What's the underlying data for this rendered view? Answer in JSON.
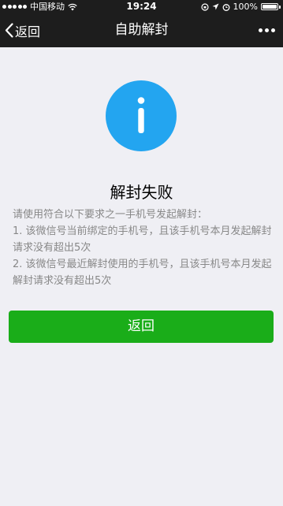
{
  "status_bar": {
    "carrier": "中国移动",
    "time": "19:24",
    "battery": "100%",
    "battery_level": 1.0
  },
  "nav": {
    "back_label": "返回",
    "title": "自助解封"
  },
  "result": {
    "title": "解封失败",
    "intro": "请使用符合以下要求之一手机号发起解封：",
    "items": [
      "1. 该微信号当前绑定的手机号，且该手机号本月发起解封请求没有超出5次",
      "2. 该微信号最近解封使用的手机号，且该手机号本月发起解封请求没有超出5次"
    ]
  },
  "actions": {
    "return_label": "返回"
  },
  "colors": {
    "icon_blue": "#23a5f0",
    "button_green": "#1aad19",
    "nav_bg": "#1d1d1d",
    "page_bg": "#efeff4"
  }
}
